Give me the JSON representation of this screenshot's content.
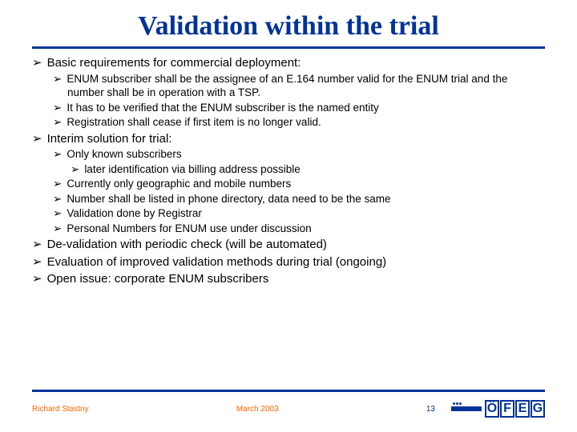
{
  "title": "Validation within the trial",
  "bullets": {
    "b1": "Basic requirements for commercial deployment:",
    "b1_1": "ENUM subscriber shall be the assignee of an E.164 number valid for the ENUM trial and the number shall be in operation with a TSP.",
    "b1_2": "It has to be verified that the ENUM subscriber is the named entity",
    "b1_3": "Registration shall cease if first item is no longer valid.",
    "b2": "Interim solution for trial:",
    "b2_1": "Only known subscribers",
    "b2_1_1": "later identification via billing address possible",
    "b2_2": "Currently only geographic and mobile numbers",
    "b2_3": "Number shall be listed in phone directory, data need to be the same",
    "b2_4": "Validation done by Registrar",
    "b2_5": "Personal Numbers for ENUM use under discussion",
    "b3": "De-validation with periodic check (will be automated)",
    "b4": "Evaluation of improved validation methods during trial (ongoing)",
    "b5": "Open issue: corporate ENUM subscribers"
  },
  "footer": {
    "author": "Richard Stastny",
    "date": "March 2003",
    "page": "13",
    "logo": "ÖFEG"
  },
  "glyph": "➢"
}
